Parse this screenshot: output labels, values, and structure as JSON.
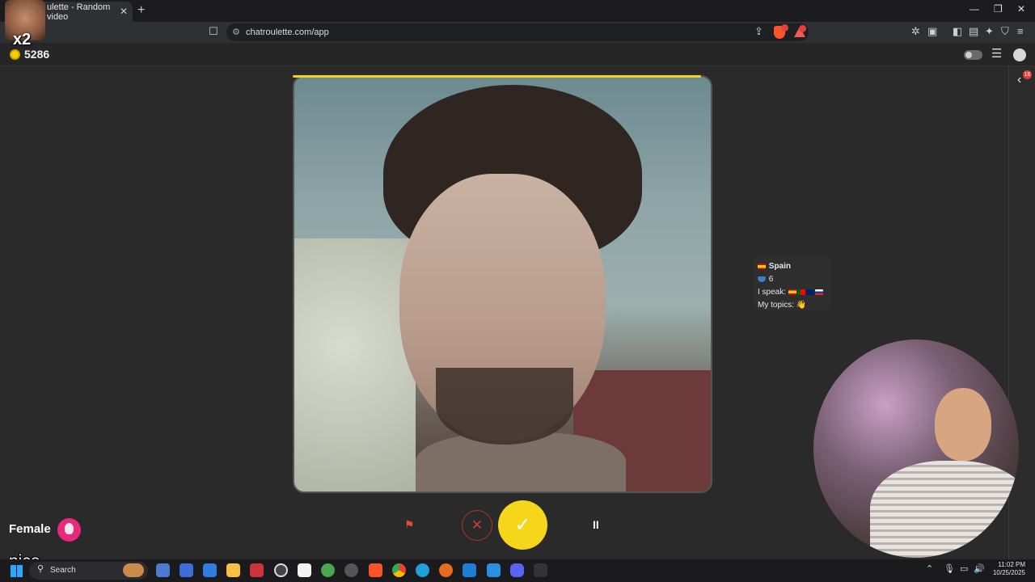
{
  "browser": {
    "tab_title": "ulette - Random video",
    "url": "chatroulette.com/app",
    "brave_shield_count": "",
    "rewards_badge": ""
  },
  "app": {
    "coins": "5286",
    "rail_badge": "16"
  },
  "partner": {
    "country": "Spain",
    "level": "6",
    "speaks_label": "I speak:",
    "topics_label": "My topics:",
    "topics_emoji": "👋",
    "languages": [
      "es",
      "pt",
      "gb",
      "ru"
    ]
  },
  "controls": {
    "gender_label": "Female",
    "skip_symbol": "✕",
    "accept_symbol": "✓",
    "pause_symbol": "II",
    "report_symbol": "⚑"
  },
  "overlay": {
    "multiplier": "x2",
    "caption": "nice"
  },
  "taskbar": {
    "search_placeholder": "Search",
    "time": "11:02 PM",
    "date": "10/25/2025"
  },
  "colors": {
    "accent_yellow": "#f6d61a",
    "skip_red": "#d13b3a",
    "female_pink": "#e8287a"
  }
}
